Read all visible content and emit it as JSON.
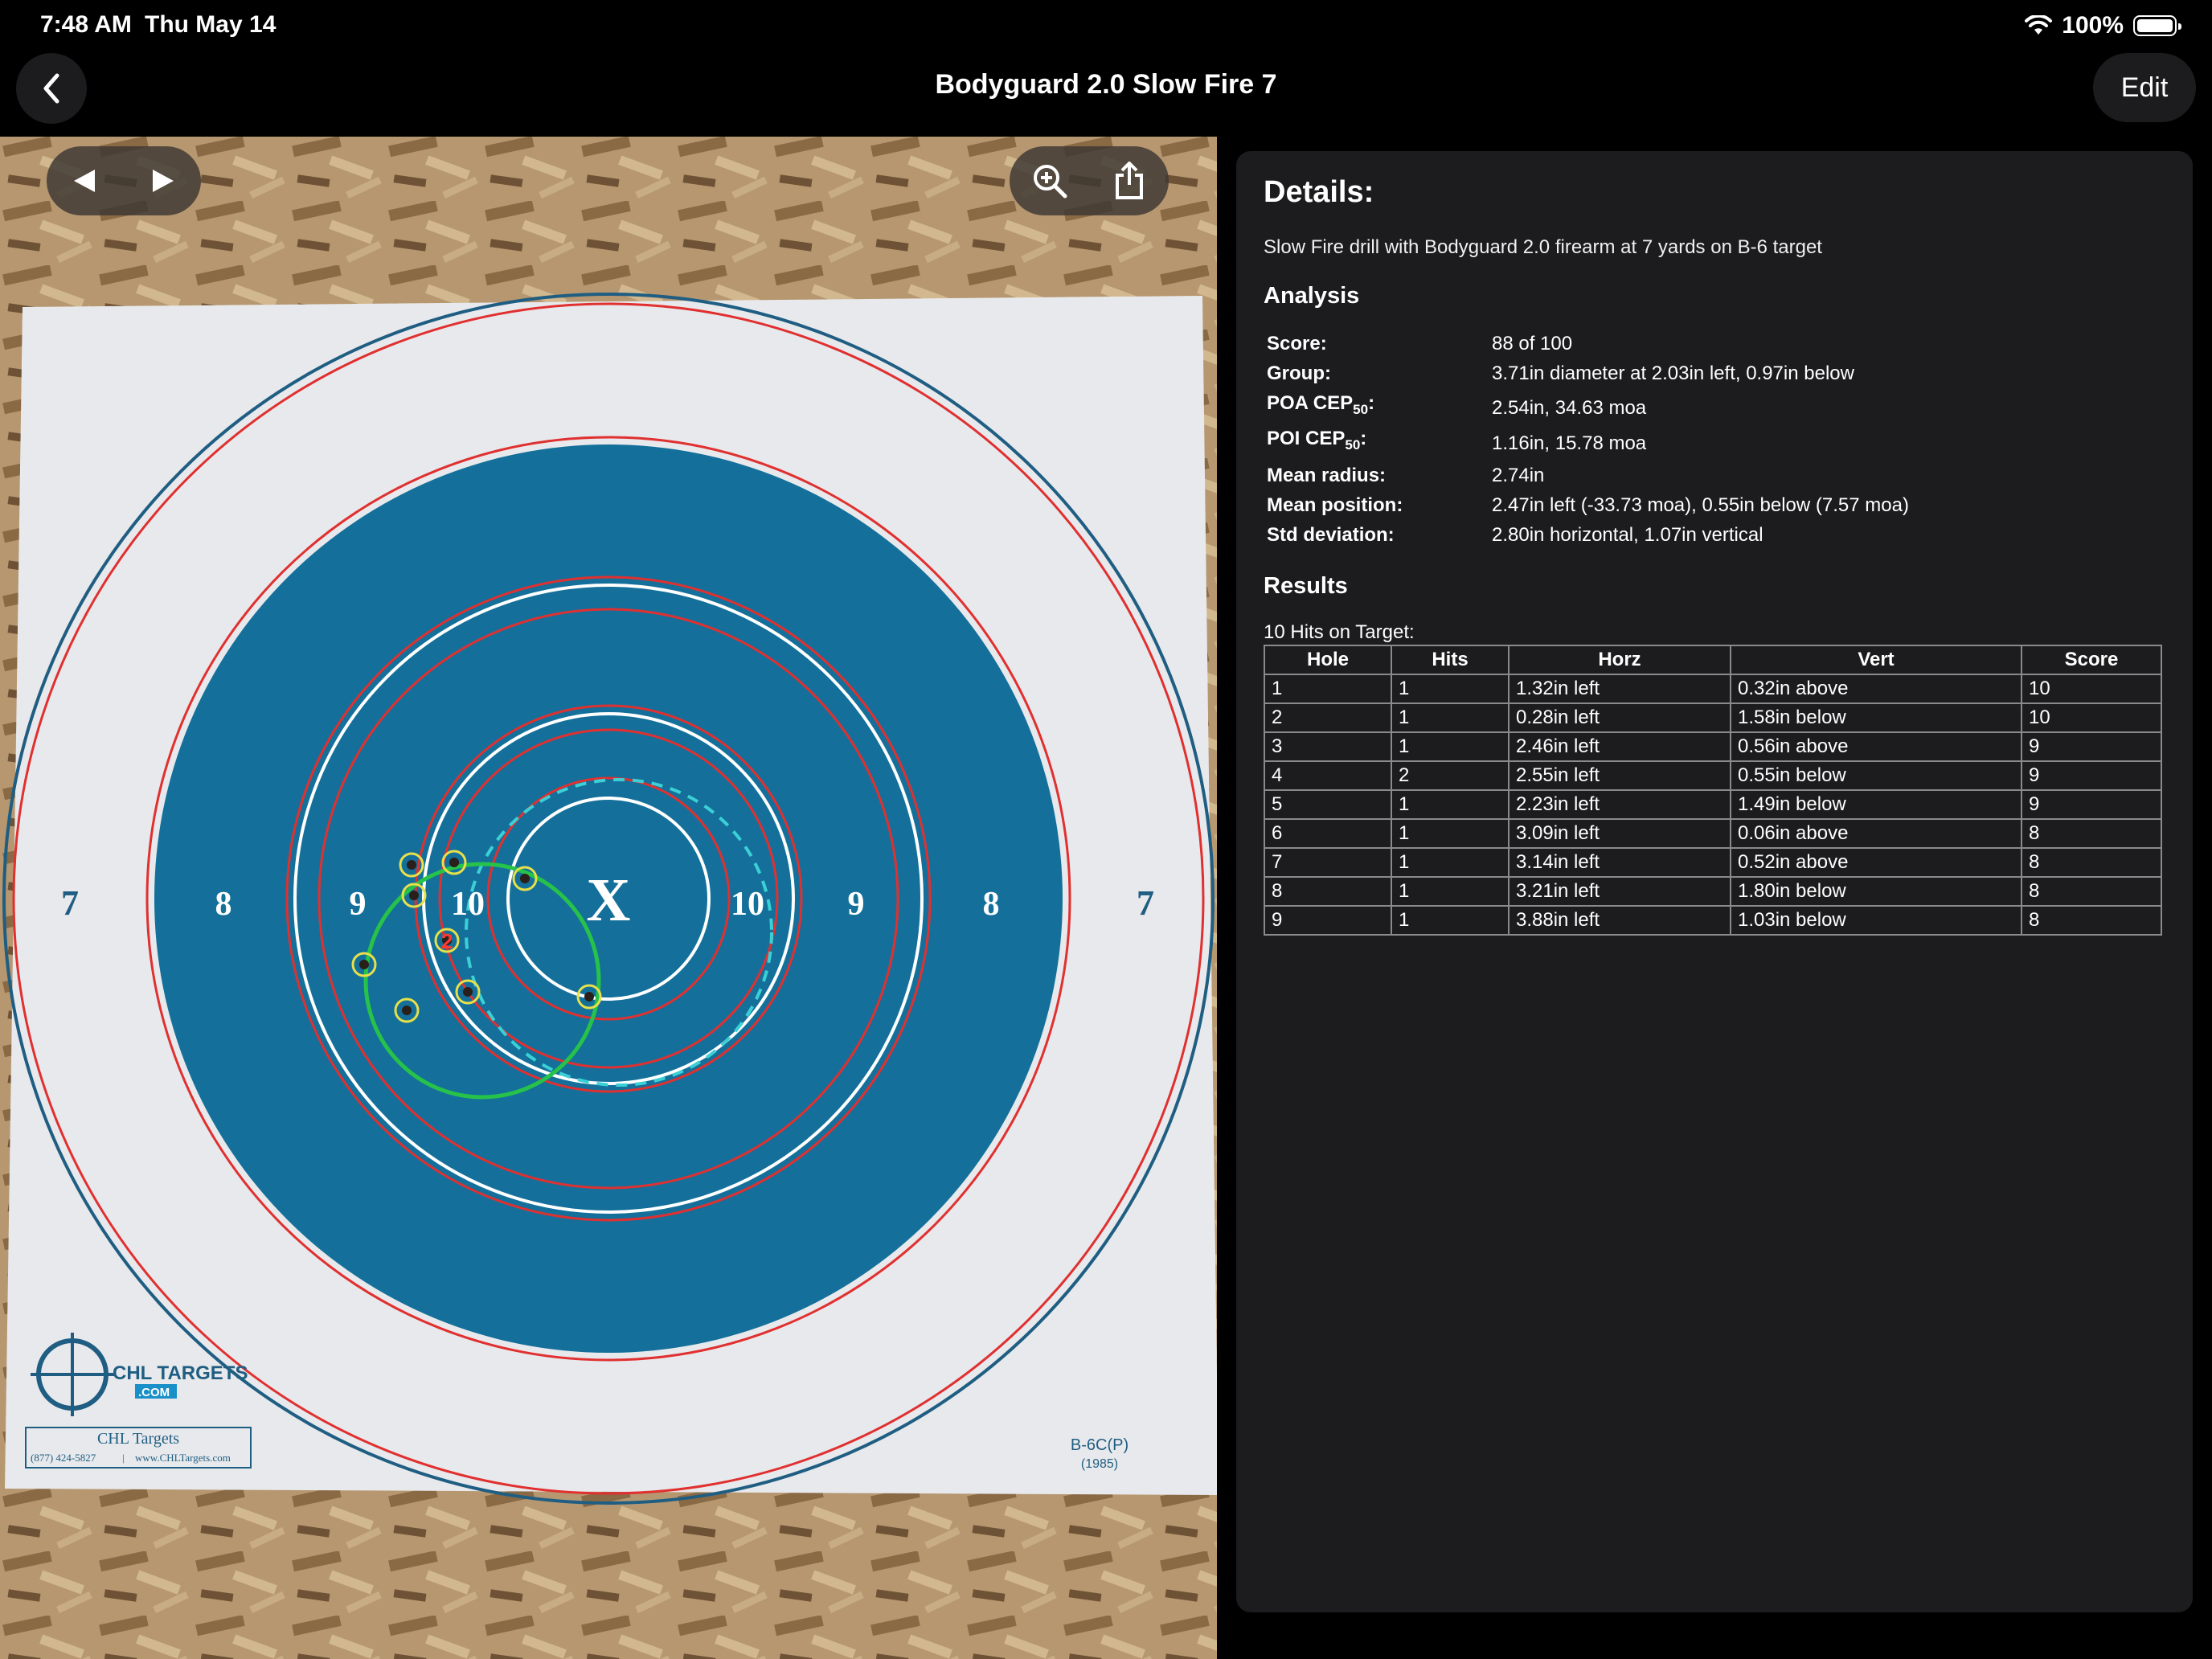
{
  "status_bar": {
    "time": "7:48 AM",
    "date": "Thu May 14",
    "battery": "100%"
  },
  "nav": {
    "title": "Bodyguard 2.0 Slow Fire 7",
    "edit_label": "Edit"
  },
  "target_image": {
    "ring_labels": [
      "7",
      "8",
      "9",
      "10",
      "X",
      "10",
      "9",
      "8",
      "7"
    ],
    "brand": "CHL TARGETS",
    "brand_sub": ".COM",
    "footer_name": "CHL Targets",
    "footer_phone": "(877) 424-5827",
    "footer_sep": "|",
    "footer_url": "www.CHLTargets.com",
    "target_code": "B-6C(P)",
    "target_year": "(1985)",
    "hole_number_label": "2"
  },
  "details": {
    "heading": "Details:",
    "description": "Slow Fire drill with Bodyguard 2.0 firearm at 7 yards on B-6 target",
    "analysis_heading": "Analysis",
    "analysis": [
      {
        "label": "Score:",
        "value": "88 of 100"
      },
      {
        "label": "Group:",
        "value": "3.71in diameter at 2.03in left, 0.97in below"
      },
      {
        "label": "POA CEP",
        "sub": "50",
        "suffix": ":",
        "value": "2.54in, 34.63 moa"
      },
      {
        "label": "POI CEP",
        "sub": "50",
        "suffix": ":",
        "value": "1.16in, 15.78 moa"
      },
      {
        "label": "Mean radius:",
        "value": "2.74in"
      },
      {
        "label": "Mean position:",
        "value": "2.47in left (-33.73 moa), 0.55in below (7.57 moa)"
      },
      {
        "label": "Std deviation:",
        "value": "2.80in horizontal, 1.07in vertical"
      }
    ],
    "results_heading": "Results",
    "hits_label": "10 Hits on Target:",
    "table": {
      "headers": [
        "Hole",
        "Hits",
        "Horz",
        "Vert",
        "Score"
      ],
      "rows": [
        [
          "1",
          "1",
          "1.32in left",
          "0.32in above",
          "10"
        ],
        [
          "2",
          "1",
          "0.28in left",
          "1.58in below",
          "10"
        ],
        [
          "3",
          "1",
          "2.46in left",
          "0.56in above",
          "9"
        ],
        [
          "4",
          "2",
          "2.55in left",
          "0.55in below",
          "9"
        ],
        [
          "5",
          "1",
          "2.23in left",
          "1.49in below",
          "9"
        ],
        [
          "6",
          "1",
          "3.09in left",
          "0.06in above",
          "8"
        ],
        [
          "7",
          "1",
          "3.14in left",
          "0.52in above",
          "8"
        ],
        [
          "8",
          "1",
          "3.21in left",
          "1.80in below",
          "8"
        ],
        [
          "9",
          "1",
          "3.88in left",
          "1.03in below",
          "8"
        ]
      ]
    }
  }
}
